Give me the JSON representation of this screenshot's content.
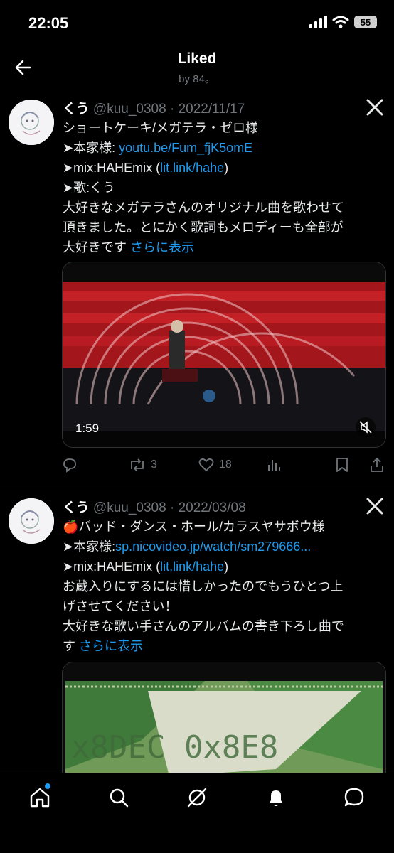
{
  "status": {
    "time": "22:05",
    "battery": "55"
  },
  "header": {
    "title": "Liked",
    "subtitle": "by 84。"
  },
  "tweets": [
    {
      "name": "くう",
      "handle": "@kuu_0308",
      "sep": "·",
      "date": "2022/11/17",
      "lines": [
        {
          "text": "ショートケーキ/メガテラ・ゼロ様"
        },
        {
          "text": "➤本家様: ",
          "link": "youtu.be/Fum_fjK5omE"
        },
        {
          "text": "➤mix:HAHEmix (",
          "link": "lit.link/hahe",
          "after": ")"
        },
        {
          "text": "➤歌:くう"
        },
        {
          "text": "大好きなメガテラさんのオリジナル曲を歌わせて"
        },
        {
          "text": "頂きました。とにかく歌詞もメロディーも全部が"
        },
        {
          "text": "大好きです ",
          "link": "さらに表示"
        }
      ],
      "media": {
        "duration": "1:59"
      },
      "actions": {
        "retweets": "3",
        "likes": "18"
      }
    },
    {
      "name": "くう",
      "handle": "@kuu_0308",
      "sep": "·",
      "date": "2022/03/08",
      "lines": [
        {
          "text": "🍎バッド・ダンス・ホール/カラスヤサボウ様"
        },
        {
          "text": "➤本家様:",
          "link": "sp.nicovideo.jp/watch/sm279666..."
        },
        {
          "text": "➤mix:HAHEmix (",
          "link": "lit.link/hahe",
          "after": ")"
        },
        {
          "text": "お蔵入りにするには惜しかったのでもうひとつ上"
        },
        {
          "text": "げさせてください！"
        },
        {
          "text": "大好きな歌い手さんのアルバムの書き下ろし曲で"
        },
        {
          "text": "す ",
          "link": "さらに表示"
        }
      ],
      "media": {
        "overlay_text": "x8DEC 0x8E8"
      }
    }
  ],
  "tabbar": [
    "home-icon",
    "search-icon",
    "grok-icon",
    "notifications-icon",
    "messages-icon"
  ],
  "colors": {
    "accent": "#1d9bf0",
    "muted": "#71767b",
    "bg": "#000000"
  }
}
